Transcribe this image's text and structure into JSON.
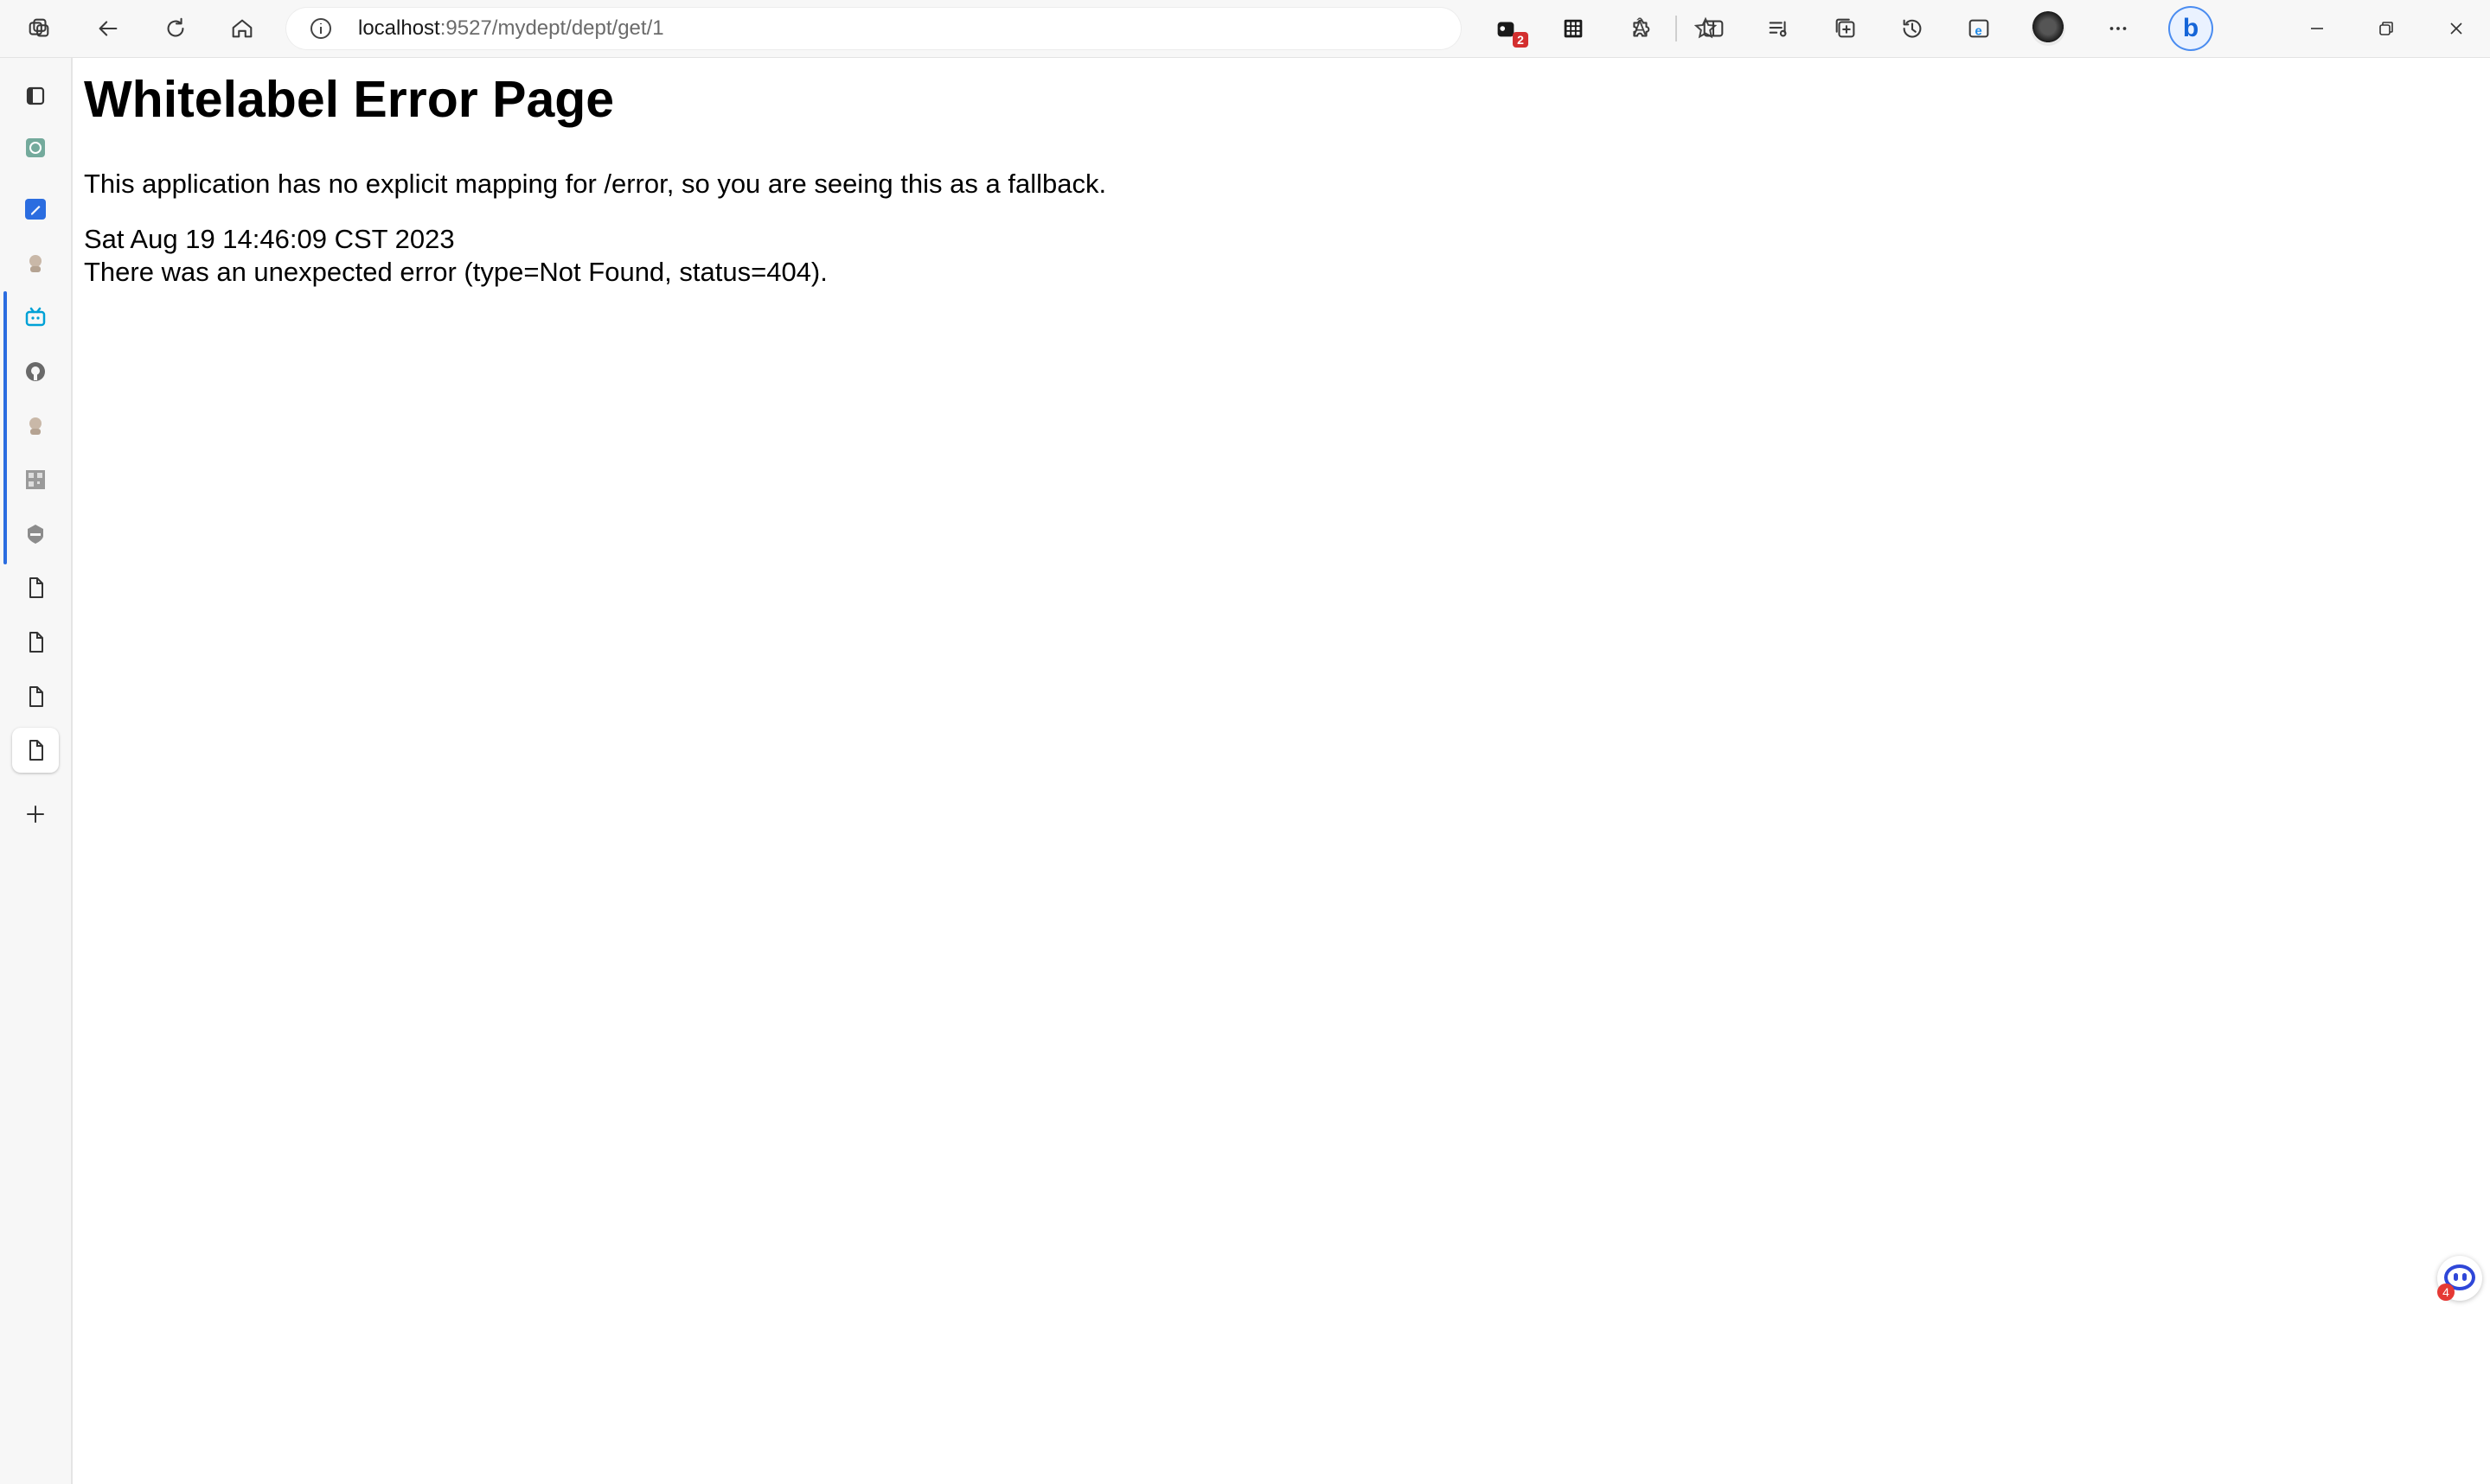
{
  "browser": {
    "url": {
      "host": "localhost",
      "path": ":9527/mydept/dept/get/1"
    },
    "read_aloud_label": "Â",
    "extension_badge": "2",
    "bing_label": "b"
  },
  "page": {
    "title": "Whitelabel Error Page",
    "description": "This application has no explicit mapping for /error, so you are seeing this as a fallback.",
    "timestamp": "Sat Aug 19 14:46:09 CST 2023",
    "error_detail": "There was an unexpected error (type=Not Found, status=404)."
  },
  "sidebar": {
    "tabs": [
      {
        "icon": "tab-actions-icon"
      },
      {
        "icon": "chatgpt-icon"
      },
      {
        "icon": "edit-app-icon"
      },
      {
        "icon": "avatar-favicon-icon"
      },
      {
        "icon": "bilibili-icon"
      },
      {
        "icon": "github-icon"
      },
      {
        "icon": "avatar-favicon-icon"
      },
      {
        "icon": "qr-favicon-icon"
      },
      {
        "icon": "shield-favicon-icon"
      },
      {
        "icon": "page-icon"
      },
      {
        "icon": "page-icon"
      },
      {
        "icon": "page-icon"
      },
      {
        "icon": "page-icon"
      }
    ],
    "new_tab_icon": "plus-icon"
  },
  "floating_assistant": {
    "badge": "4"
  },
  "colors": {
    "accent": "#2b6de0",
    "badge": "#d32f2f",
    "bilibili": "#00a1d6"
  }
}
